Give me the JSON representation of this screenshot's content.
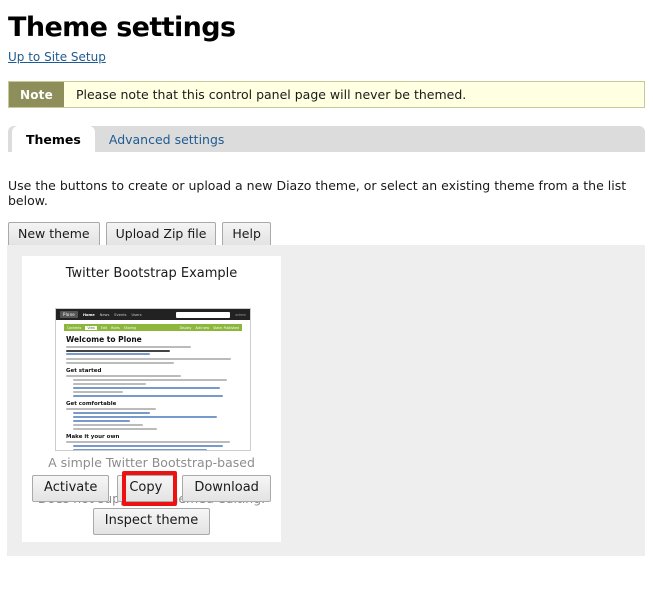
{
  "header": {
    "title": "Theme settings",
    "breadcrumb_label": "Up to Site Setup"
  },
  "note": {
    "label": "Note",
    "text": "Please note that this control panel page will never be themed.",
    "label_bg": "#8e8e5b",
    "body_bg": "#ffffe1",
    "border": "#c8c89a"
  },
  "tabs": [
    {
      "label": "Themes",
      "active": true
    },
    {
      "label": "Advanced settings",
      "active": false
    }
  ],
  "intro": {
    "text": "Use the buttons to create or upload a new Diazo theme, or select an existing theme from a the list below."
  },
  "top_actions": [
    {
      "label": "New theme",
      "name": "new-theme-button"
    },
    {
      "label": "Upload Zip file",
      "name": "upload-zip-file-button"
    },
    {
      "label": "Help",
      "name": "help-button"
    }
  ],
  "themes": [
    {
      "name": "Twitter Bootstrap Example",
      "description_line1": "A simple Twitter Bootstrap-based theme.",
      "description_line2": "Does not support unthemed editing.",
      "actions_row1": [
        {
          "label": "Activate",
          "name": "activate-button"
        },
        {
          "label": "Copy",
          "name": "copy-button"
        },
        {
          "label": "Download",
          "name": "download-button"
        }
      ],
      "actions_row2": [
        {
          "label": "Inspect theme",
          "name": "inspect-theme-button"
        }
      ],
      "preview": {
        "site_logo": "Plone",
        "top_nav": [
          "Home",
          "News",
          "Events",
          "Users"
        ],
        "user_menu": "admin",
        "search_placeholder": "Search",
        "content_tabs": [
          "Contents",
          "View",
          "Edit",
          "Rules",
          "Sharing"
        ],
        "content_menus": [
          "Display",
          "Add new",
          "State: Published"
        ],
        "page_heading": "Welcome to Plone",
        "sections": [
          "Get started",
          "Get comfortable",
          "Make it your own"
        ]
      }
    }
  ],
  "annotation": {
    "target": "copy-button",
    "highlight_color": "#ee1111"
  },
  "colors": {
    "page_bg": "#ffffff",
    "panel_bg": "#eeeeee",
    "card_bg": "#ffffff",
    "tab_bar_bg": "#dcdcdc",
    "link": "#205c90",
    "muted_text": "#8d8d8d"
  }
}
